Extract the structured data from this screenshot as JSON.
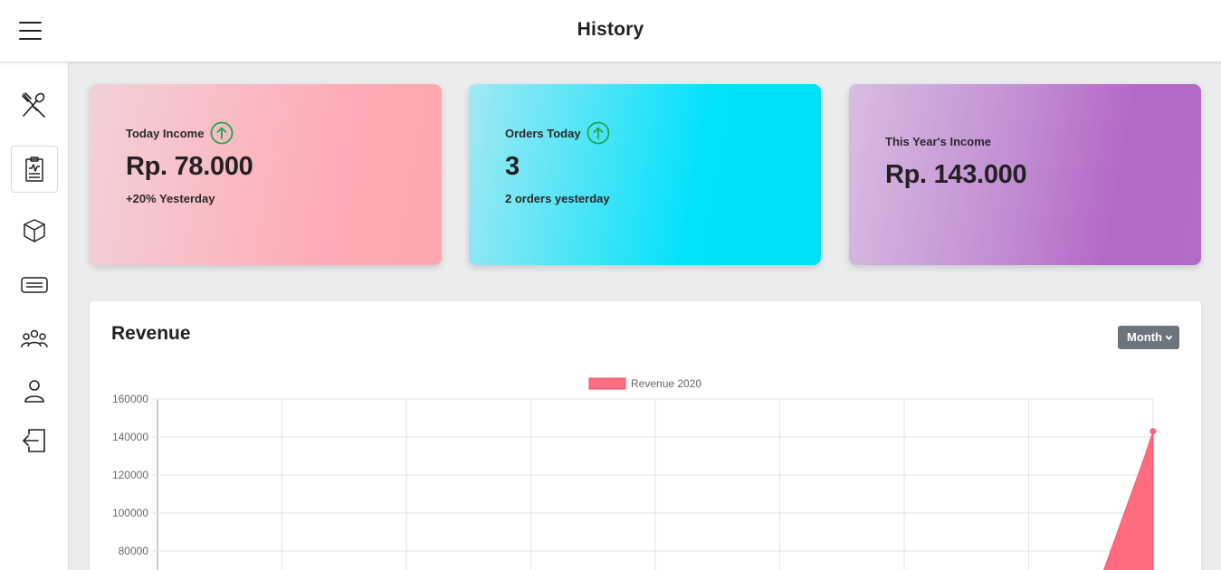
{
  "header": {
    "title": "History"
  },
  "sidebar": {
    "items": [
      {
        "icon": "fork-knife-icon",
        "active": false
      },
      {
        "icon": "clipboard-icon",
        "active": true
      },
      {
        "icon": "box-icon",
        "active": false
      },
      {
        "icon": "card-icon",
        "active": false
      },
      {
        "icon": "users-icon",
        "active": false
      },
      {
        "icon": "user-icon",
        "active": false
      },
      {
        "icon": "logout-icon",
        "active": false
      }
    ]
  },
  "cards": {
    "today_income": {
      "label": "Today Income",
      "value": "Rp. 78.000",
      "sub": "+20% Yesterday",
      "icon": "arrow-up-circle-icon"
    },
    "orders_today": {
      "label": "Orders Today",
      "value": "3",
      "sub": "2 orders yesterday",
      "icon": "arrow-up-circle-icon"
    },
    "year_income": {
      "label": "This Year's Income",
      "value": "Rp. 143.000"
    }
  },
  "revenue": {
    "title": "Revenue",
    "period_button": "Month"
  },
  "colors": {
    "series": "#ff6b7f",
    "up_arrow": "#1ea84a",
    "month_button": "#6c757d"
  },
  "chart_data": {
    "type": "area",
    "legend": [
      "Revenue 2020"
    ],
    "legend_position": "top",
    "grid": true,
    "y_ticks": [
      160000,
      140000,
      120000,
      100000,
      80000
    ],
    "ylim": [
      80000,
      160000
    ],
    "series": [
      {
        "name": "Revenue 2020",
        "points_visible": [
          {
            "x_index": 8,
            "y": 143000
          }
        ]
      }
    ]
  }
}
